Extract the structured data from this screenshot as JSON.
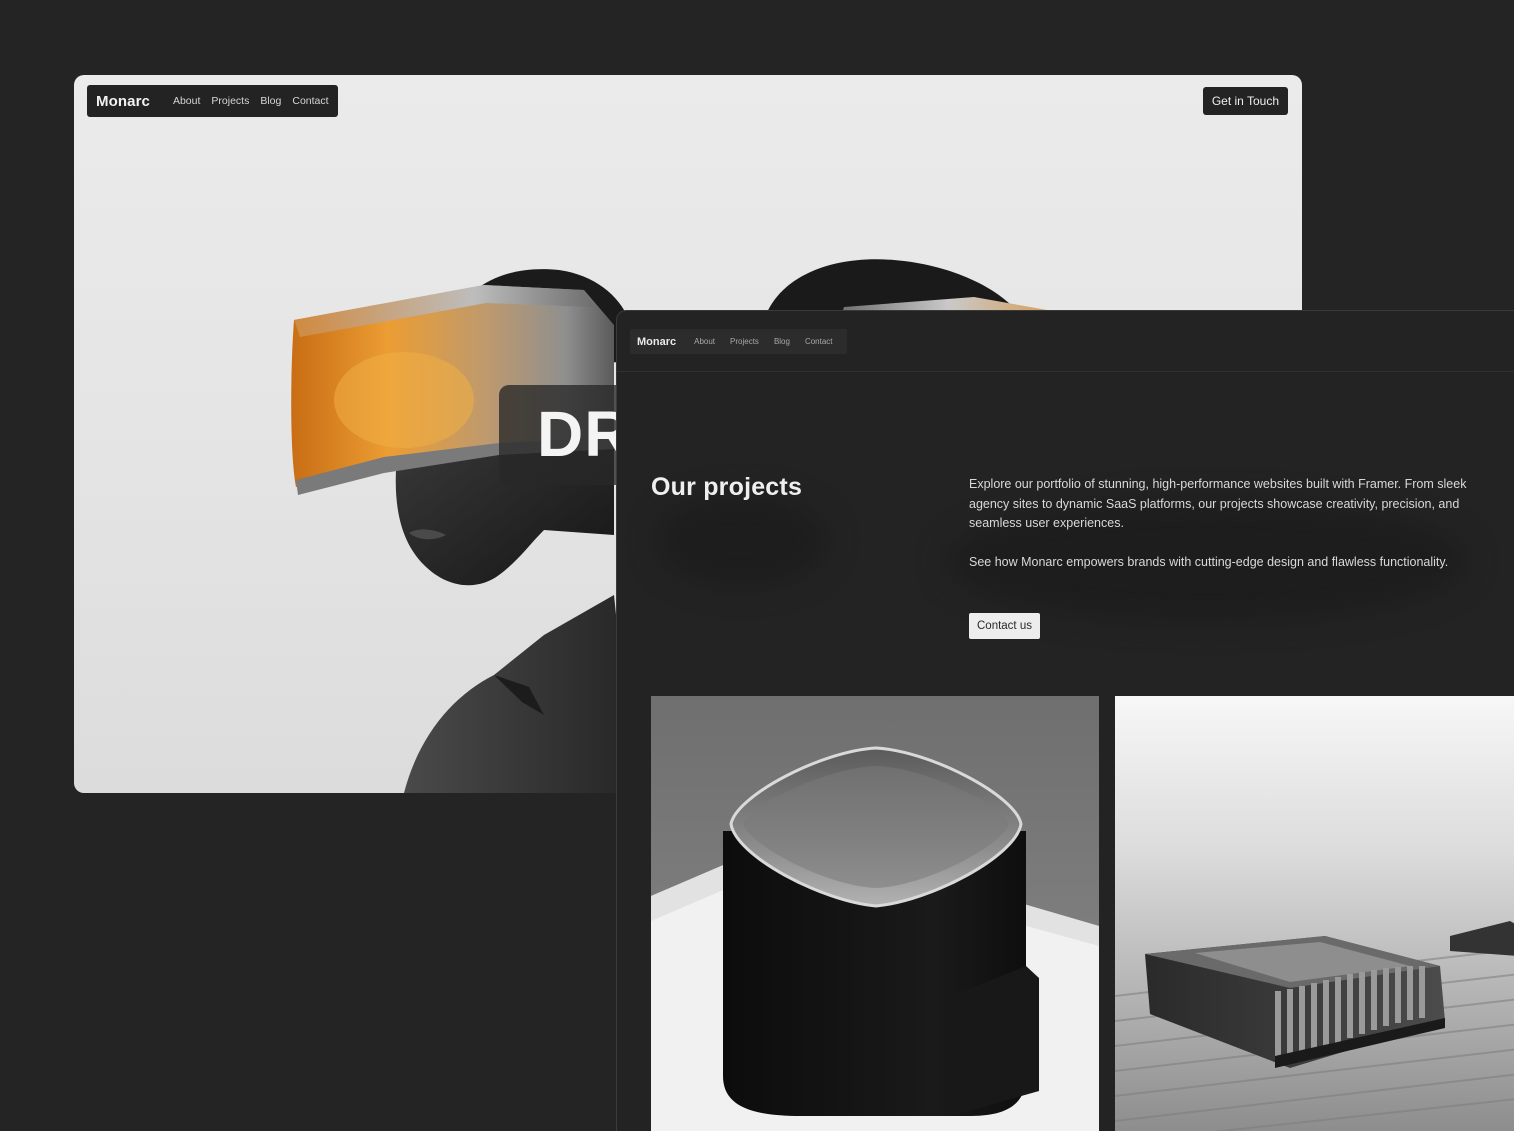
{
  "back_window": {
    "brand": "Monarc",
    "nav": [
      {
        "label": "About"
      },
      {
        "label": "Projects"
      },
      {
        "label": "Blog"
      },
      {
        "label": "Contact"
      }
    ],
    "cta_label": "Get in Touch",
    "hero_word": "DR"
  },
  "front_window": {
    "brand": "Monarc",
    "nav": [
      {
        "label": "About"
      },
      {
        "label": "Projects"
      },
      {
        "label": "Blog"
      },
      {
        "label": "Contact"
      }
    ],
    "title": "Our projects",
    "description": [
      "Explore our portfolio of stunning, high-performance websites built with Framer. From sleek agency sites to dynamic SaaS platforms, our projects showcase creativity, precision, and seamless user experiences.",
      "See how Monarc empowers brands with cutting-edge design and flawless functionality."
    ],
    "cta_label": "Contact us"
  },
  "colors": {
    "background": "#242424",
    "hero_light": "#e6e6e6",
    "visor_orange": "#e99a2e",
    "panel_dark": "#232323",
    "button_light": "#ededed"
  }
}
